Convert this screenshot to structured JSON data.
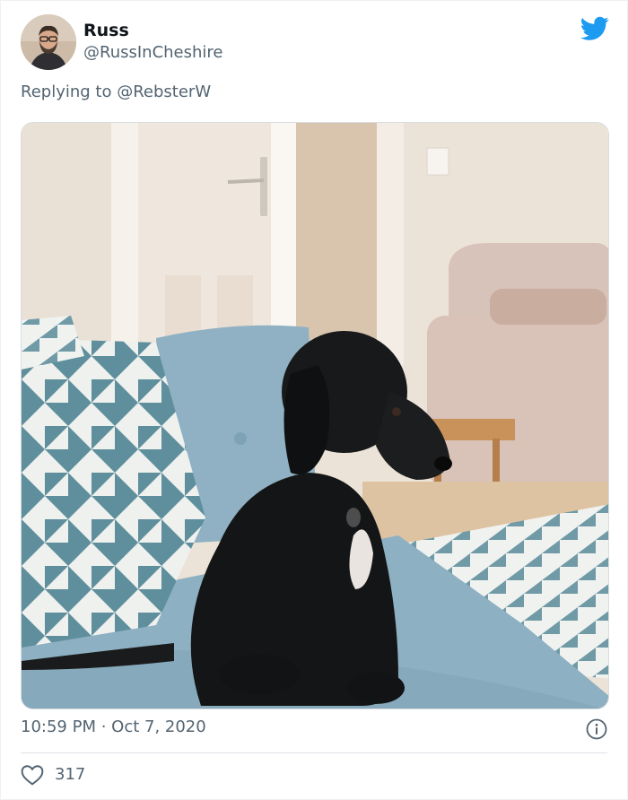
{
  "tweet": {
    "author_name": "Russ",
    "author_handle": "@RussInCheshire",
    "replying_prefix": "Replying to",
    "replying_to": "@RebsterW",
    "timestamp": "10:59 PM · Oct 7, 2020",
    "like_count": "317"
  },
  "colors": {
    "twitter_blue": "#1d9bf0",
    "secondary_text": "#536471"
  },
  "icons": {
    "logo": "twitter-bird-icon",
    "info": "info-icon",
    "like": "heart-icon"
  }
}
